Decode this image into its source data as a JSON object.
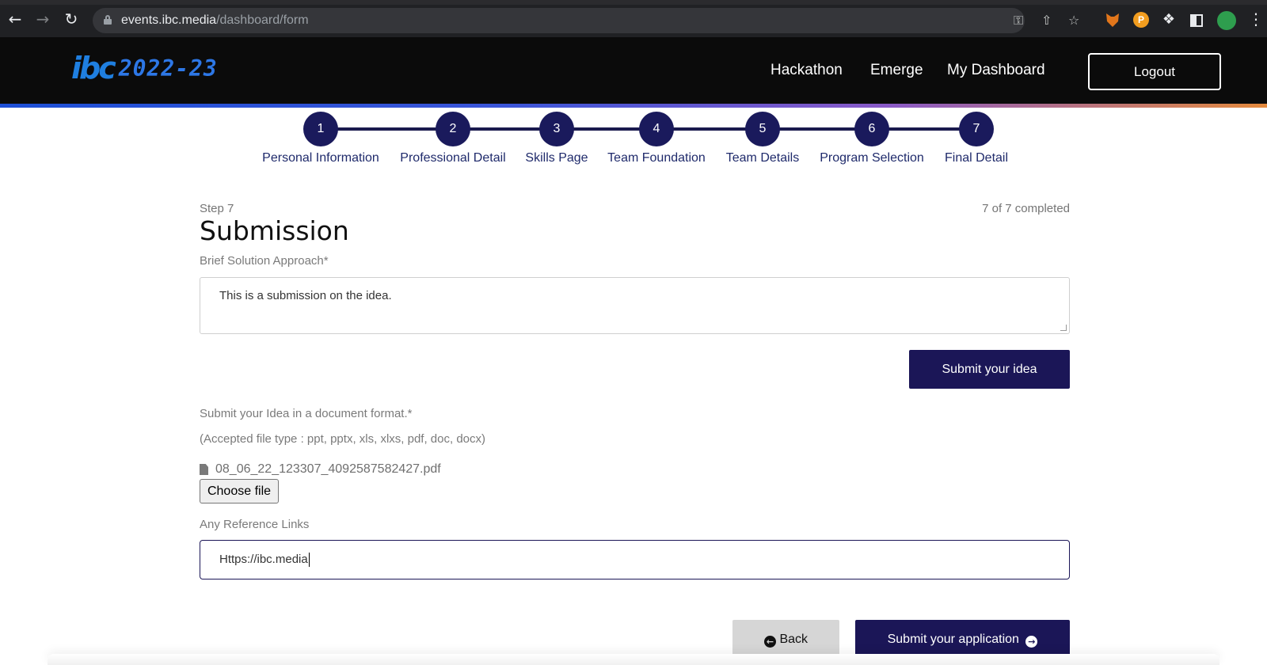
{
  "browser": {
    "url_host": "events.ibc.media",
    "url_path": "/dashboard/form"
  },
  "site": {
    "logo_text": "ibc",
    "logo_year": "2022-23",
    "nav": [
      "Hackathon",
      "Emerge",
      "My Dashboard"
    ],
    "logout_label": "Logout"
  },
  "stepper": {
    "steps": [
      {
        "number": "1",
        "label": "Personal Information"
      },
      {
        "number": "2",
        "label": "Professional Detail"
      },
      {
        "number": "3",
        "label": "Skills Page"
      },
      {
        "number": "4",
        "label": "Team Foundation"
      },
      {
        "number": "5",
        "label": "Team Details"
      },
      {
        "number": "6",
        "label": "Program Selection"
      },
      {
        "number": "7",
        "label": "Final Detail"
      }
    ]
  },
  "form": {
    "step_label": "Step 7",
    "progress_text": "7 of 7 completed",
    "title": "Submission",
    "approach_label": "Brief Solution Approach*",
    "approach_value": "This is a submission on the idea.",
    "submit_idea_label": "Submit your idea",
    "document_label": "Submit your Idea in a document format.*",
    "accepted_types": "(Accepted file type : ppt, pptx, xls, xlxs, pdf, doc, docx)",
    "file_name": "08_06_22_123307_4092587582427.pdf",
    "choose_file_label": "Choose file",
    "links_label": "Any Reference Links",
    "links_value": "Https://ibc.media",
    "back_label": "Back",
    "submit_application_label": "Submit your application"
  },
  "colors": {
    "primary": "#1b1657",
    "header_bg": "#0b0b0b",
    "step_circle": "#1a1a5c"
  }
}
